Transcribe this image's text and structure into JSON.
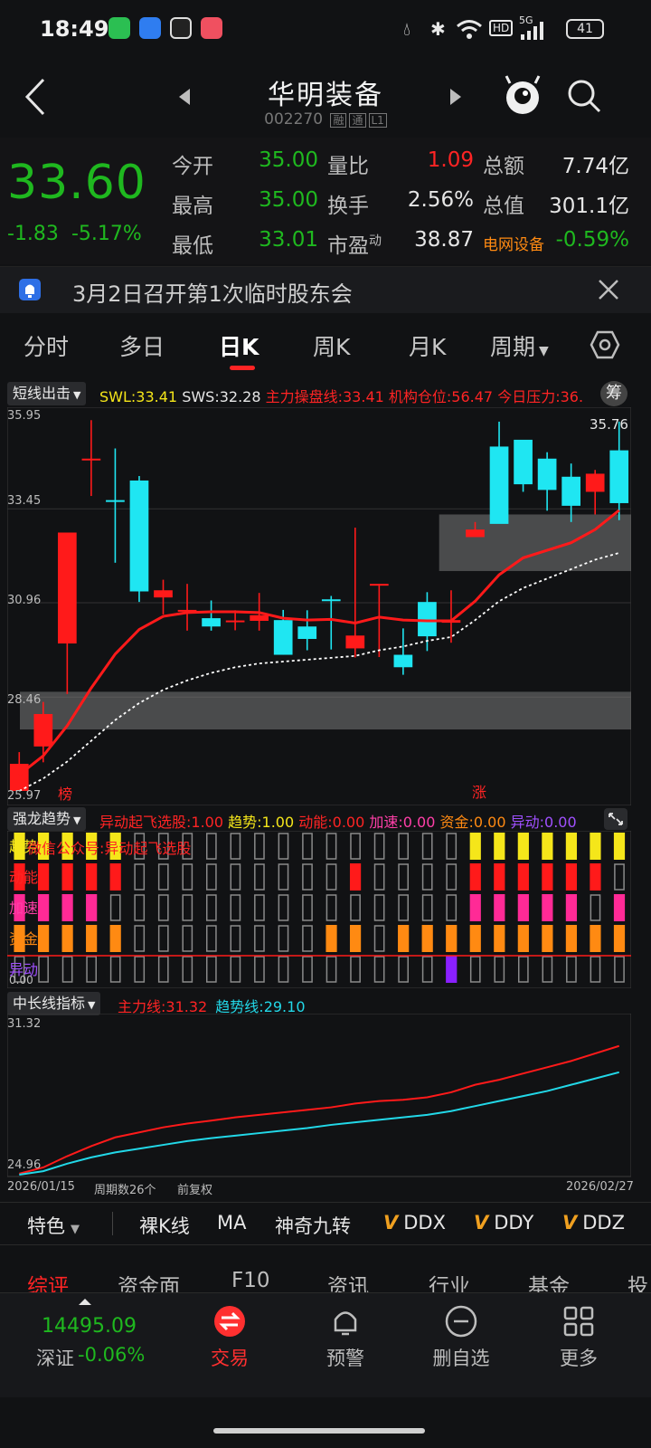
{
  "status_bar": {
    "time": "18:49",
    "battery": "41",
    "network": "5G",
    "hd": "HD",
    "icons": [
      "wechat-icon",
      "cloud-app-icon",
      "messenger-icon",
      "video-app-icon",
      "water-drop-icon",
      "bluetooth-icon",
      "wifi-icon",
      "signal-icon"
    ]
  },
  "header": {
    "title": "华明装备",
    "code": "002270",
    "tags": [
      "融",
      "通",
      "L1"
    ]
  },
  "quote": {
    "price": "33.60",
    "change": "-1.83",
    "change_pct": "-5.17%",
    "rows": [
      {
        "l1": "今开",
        "v1": "35.00",
        "l2": "量比",
        "v2": "1.09",
        "l3": "总额",
        "v3": "7.74亿"
      },
      {
        "l1": "最高",
        "v1": "35.00",
        "l2": "换手",
        "v2": "2.56%",
        "l3": "总值",
        "v3": "301.1亿"
      },
      {
        "l1": "最低",
        "v1": "33.01",
        "l2": "市盈",
        "l2sup": "动",
        "v2": "38.87",
        "l3": "电网设备",
        "v3": "-0.59%"
      }
    ]
  },
  "notice": {
    "text": "3月2日召开第1次临时股东会"
  },
  "tabs": {
    "items": [
      "分时",
      "多日",
      "日K",
      "周K",
      "月K",
      "周期"
    ],
    "active": "日K"
  },
  "indicator_main": {
    "name": "短线出击",
    "items": [
      {
        "label": "SWL:33.41",
        "color": "#f5e61a"
      },
      {
        "label": "SWS:32.28",
        "color": "#e6e6e6"
      },
      {
        "label": "主力操盘线:33.41",
        "color": "#ff2424"
      },
      {
        "label": "机构仓位:56.47",
        "color": "#ff2424"
      },
      {
        "label": "今日压力:36.",
        "color": "#ff2424"
      }
    ],
    "chip_button": "筹"
  },
  "chart_labels": {
    "y_ticks": [
      "35.95",
      "33.45",
      "30.96",
      "28.46",
      "25.97"
    ],
    "high_label": "35.76",
    "marker_1": "榜",
    "marker_2": "涨"
  },
  "indicator_dragon": {
    "name": "强龙趋势",
    "items": [
      {
        "label": "异动起飞选股:1.00",
        "color": "#ff2424"
      },
      {
        "label": "趋势:1.00",
        "color": "#f5e61a"
      },
      {
        "label": "动能:0.00",
        "color": "#ff2424"
      },
      {
        "label": "加速:0.00",
        "color": "#ff3fa8"
      },
      {
        "label": "资金:0.00",
        "color": "#ff8a12"
      },
      {
        "label": "异动:0.00",
        "color": "#a050ff"
      }
    ],
    "row_labels": [
      "趋势",
      "动能",
      "加速",
      "资金",
      "异动"
    ],
    "watermark": "微信公众号:异动起飞选股",
    "zero_label": "0.00"
  },
  "indicator_midlong": {
    "name": "中长线指标",
    "items": [
      {
        "label": "主力线:31.32",
        "color": "#ff2424"
      },
      {
        "label": "趋势线:29.10",
        "color": "#22d8e8"
      }
    ],
    "y_top": "31.32",
    "y_bottom": "24.96",
    "date_start": "2026/01/15",
    "period_count": "周期数26个",
    "adjust": "前复权",
    "date_end": "2026/02/27"
  },
  "chart_data": [
    {
      "type": "candlestick",
      "title": "",
      "ylim": [
        25.97,
        35.95
      ],
      "x": [
        "2026/01/15",
        "",
        "",
        "",
        "",
        "",
        "",
        "",
        "",
        "",
        "",
        "",
        "",
        "",
        "",
        "",
        "",
        "",
        "",
        "",
        "",
        "",
        "",
        "",
        "",
        "2026/02/27"
      ],
      "open": [
        25.97,
        27.15,
        29.88,
        34.78,
        33.68,
        34.2,
        31.1,
        30.77,
        30.55,
        30.49,
        30.48,
        30.5,
        30.33,
        31.05,
        29.75,
        31.46,
        29.58,
        30.98,
        30.43,
        32.7,
        35.1,
        35.28,
        34.78,
        34.3,
        33.9,
        35.0
      ],
      "close": [
        26.69,
        28.01,
        32.82,
        34.78,
        33.66,
        31.26,
        31.29,
        30.77,
        30.33,
        30.49,
        30.63,
        29.58,
        30.0,
        31.02,
        30.09,
        31.46,
        29.25,
        30.07,
        30.5,
        32.9,
        33.05,
        34.1,
        33.95,
        33.53,
        34.38,
        33.6
      ],
      "high": [
        27.0,
        28.33,
        32.82,
        35.8,
        35.05,
        34.32,
        31.57,
        31.46,
        31.02,
        30.76,
        31.22,
        30.77,
        30.76,
        31.14,
        32.95,
        31.46,
        30.28,
        31.24,
        31.29,
        33.1,
        35.76,
        35.2,
        34.95,
        34.65,
        34.48,
        35.76
      ],
      "low": [
        25.97,
        26.73,
        28.54,
        33.79,
        32.02,
        30.98,
        30.65,
        30.22,
        30.22,
        30.23,
        30.22,
        29.58,
        29.7,
        29.72,
        29.51,
        29.52,
        29.05,
        29.68,
        29.9,
        32.7,
        33.2,
        33.9,
        33.4,
        33.1,
        33.3,
        33.15
      ],
      "series": [
        {
          "name": "主力操盘线",
          "values": [
            26.4,
            26.9,
            27.7,
            28.7,
            29.6,
            30.25,
            30.6,
            30.7,
            30.72,
            30.72,
            30.7,
            30.55,
            30.5,
            30.52,
            30.42,
            30.58,
            30.5,
            30.48,
            30.48,
            31.0,
            31.7,
            32.15,
            32.35,
            32.55,
            32.9,
            33.41
          ]
        },
        {
          "name": "SWS",
          "values": [
            25.97,
            26.3,
            26.75,
            27.3,
            27.85,
            28.3,
            28.65,
            28.9,
            29.1,
            29.25,
            29.35,
            29.4,
            29.45,
            29.5,
            29.55,
            29.7,
            29.8,
            29.95,
            30.05,
            30.5,
            31.0,
            31.35,
            31.6,
            31.85,
            32.1,
            32.28
          ]
        }
      ],
      "zones": [
        {
          "from": 27.6,
          "to": 28.6
        },
        {
          "from": 31.8,
          "to": 33.3
        }
      ]
    },
    {
      "type": "heatmap",
      "title": "",
      "rows": [
        "趋势",
        "动能",
        "加速",
        "资金",
        "异动"
      ],
      "values": [
        [
          1,
          1,
          1,
          1,
          1,
          0,
          0,
          0,
          0,
          0,
          0,
          0,
          0,
          0,
          0,
          0,
          0,
          0,
          0,
          1,
          1,
          1,
          1,
          1,
          1,
          1
        ],
        [
          1,
          1,
          1,
          1,
          1,
          0,
          0,
          0,
          0,
          0,
          0,
          0,
          0,
          0,
          1,
          0,
          0,
          0,
          0,
          1,
          1,
          1,
          1,
          1,
          1,
          0
        ],
        [
          1,
          1,
          1,
          1,
          0,
          0,
          0,
          0,
          0,
          0,
          0,
          0,
          0,
          0,
          0,
          0,
          0,
          0,
          0,
          1,
          1,
          1,
          1,
          1,
          0,
          1
        ],
        [
          1,
          1,
          1,
          1,
          1,
          0,
          0,
          0,
          0,
          0,
          0,
          0,
          0,
          1,
          1,
          0,
          1,
          1,
          1,
          1,
          1,
          1,
          1,
          1,
          1,
          1
        ],
        [
          0,
          0,
          0,
          0,
          0,
          0,
          0,
          0,
          0,
          0,
          0,
          0,
          0,
          0,
          0,
          0,
          0,
          0,
          1,
          0,
          0,
          0,
          0,
          0,
          0,
          0
        ]
      ]
    },
    {
      "type": "line",
      "title": "",
      "ylim": [
        24.96,
        31.32
      ],
      "series": [
        {
          "name": "主力线",
          "values": [
            25.0,
            25.25,
            25.7,
            26.1,
            26.45,
            26.65,
            26.85,
            27.0,
            27.12,
            27.25,
            27.35,
            27.45,
            27.55,
            27.65,
            27.8,
            27.9,
            27.95,
            28.05,
            28.25,
            28.55,
            28.75,
            29.0,
            29.25,
            29.5,
            29.8,
            30.1
          ]
        },
        {
          "name": "趋势线",
          "values": [
            24.96,
            25.1,
            25.4,
            25.65,
            25.85,
            26.0,
            26.15,
            26.3,
            26.42,
            26.52,
            26.62,
            26.72,
            26.82,
            26.95,
            27.05,
            27.15,
            27.25,
            27.35,
            27.5,
            27.7,
            27.9,
            28.1,
            28.3,
            28.55,
            28.8,
            29.05
          ]
        }
      ]
    }
  ],
  "func_bar": {
    "items": [
      "特色",
      "裸K线",
      "MA",
      "神奇九转",
      "DDX",
      "DDY",
      "DDZ"
    ]
  },
  "bottom_tabs": {
    "items": [
      "综评",
      "资金面",
      "F10",
      "资讯",
      "行业",
      "基金",
      "投"
    ],
    "active": "综评"
  },
  "trade_bar": {
    "index_value": "14495.09",
    "index_name": "深证",
    "index_change": "-0.06%",
    "items": [
      "交易",
      "预警",
      "删自选",
      "更多"
    ]
  }
}
